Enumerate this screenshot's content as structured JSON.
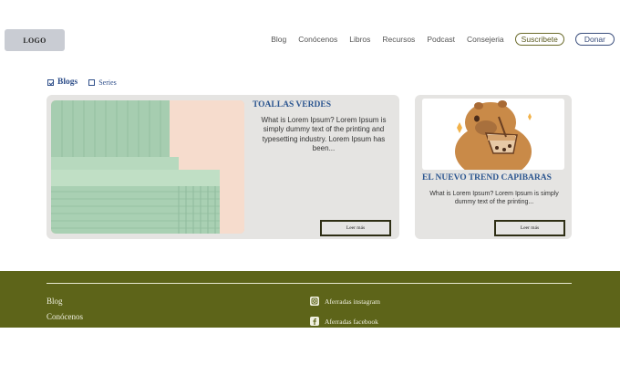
{
  "header": {
    "logo": "LOGO",
    "nav": [
      "Blog",
      "Conócenos",
      "Libros",
      "Recursos",
      "Podcast",
      "Consejeria"
    ],
    "subscribe": "Suscribete",
    "donate": "Donar"
  },
  "tabs": [
    {
      "label": "Blogs",
      "checked": true
    },
    {
      "label": "Series",
      "checked": false
    }
  ],
  "cards": [
    {
      "title": "TOALLAS VERDES",
      "text": "What is Lorem Ipsum? Lorem Ipsum is simply dummy text of the printing and typesetting industry. Lorem Ipsum has been...",
      "button": "Leer más",
      "image": "green-towels"
    },
    {
      "title": "EL NUEVO TREND CAPIBARAS",
      "text": "What is Lorem Ipsum? Lorem Ipsum is simply dummy text of the printing...",
      "button": "Leer más",
      "image": "capybara-boba"
    }
  ],
  "footer": {
    "links": [
      "Blog",
      "Conócenos"
    ],
    "social": [
      {
        "label": "Aferradas instagram",
        "icon": "instagram-icon"
      },
      {
        "label": "Aferradas facebook",
        "icon": "facebook-icon"
      }
    ]
  },
  "colors": {
    "accent": "#2c5690",
    "footer": "#5d6419",
    "card": "#e5e4e2"
  }
}
